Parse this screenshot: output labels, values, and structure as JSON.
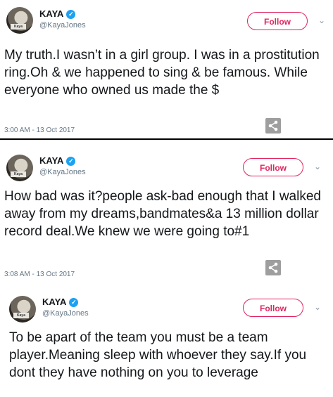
{
  "tweets": [
    {
      "name": "KAYA",
      "handle": "@KayaJones",
      "avatar_tag": "Kaya",
      "follow": "Follow",
      "text": "My truth.I wasn’t in a girl group. I was in a prostitution ring.Oh & we happened to sing & be famous. While everyone who owned us made the $",
      "time": "3:00 AM - 13 Oct 2017"
    },
    {
      "name": "KAYA",
      "handle": "@KayaJones",
      "avatar_tag": "Kaya",
      "follow": "Follow",
      "text": "How bad was it?people ask-bad enough that I walked away from my dreams,bandmates&a 13 million dollar record deal.We knew we were going to#1",
      "time": "3:08 AM - 13 Oct 2017"
    },
    {
      "name": "KAYA",
      "handle": "@KayaJones",
      "avatar_tag": "Kaya",
      "follow": "Follow",
      "text": "To be apart of the team you must be a team player.Meaning sleep with whoever they say.If you dont they have nothing on you to leverage"
    }
  ],
  "icons": {
    "verified": "verified-check-icon",
    "chevron": "chevron-down-icon",
    "share": "share-icon"
  },
  "colors": {
    "follow": "#e0245e",
    "verified": "#1da1f2",
    "muted": "#657786"
  }
}
